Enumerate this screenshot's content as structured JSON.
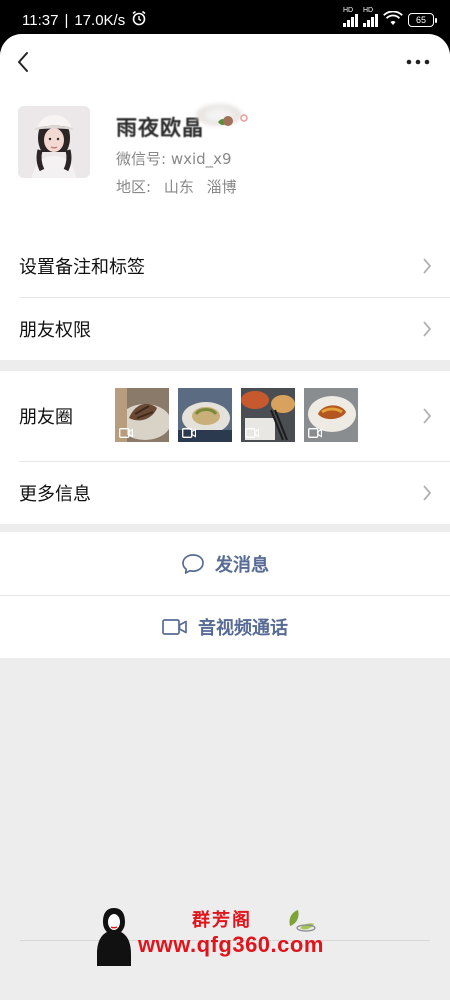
{
  "status_bar": {
    "time": "11:37",
    "net_speed": "17.0K/s",
    "sim1_label": "HD",
    "sim2_label": "HD",
    "battery": "65"
  },
  "profile": {
    "nickname": "雨夜欧晶",
    "wxid_label": "微信号:",
    "wxid_value": "wxid_x9",
    "region_label": "地区:",
    "region_province": "山东",
    "region_city": "淄博"
  },
  "settings": {
    "remark_tags": "设置备注和标签",
    "friend_permissions": "朋友权限"
  },
  "details": {
    "moments": "朋友圈",
    "more_info": "更多信息"
  },
  "actions": {
    "send_message": "发消息",
    "video_call": "音视频通话"
  },
  "watermark": {
    "brand": "群芳阁",
    "domain": "www.qfg360.com"
  },
  "colors": {
    "link_blue": "#576b95",
    "watermark_red": "#e0141b",
    "page_bg": "#ededed"
  }
}
